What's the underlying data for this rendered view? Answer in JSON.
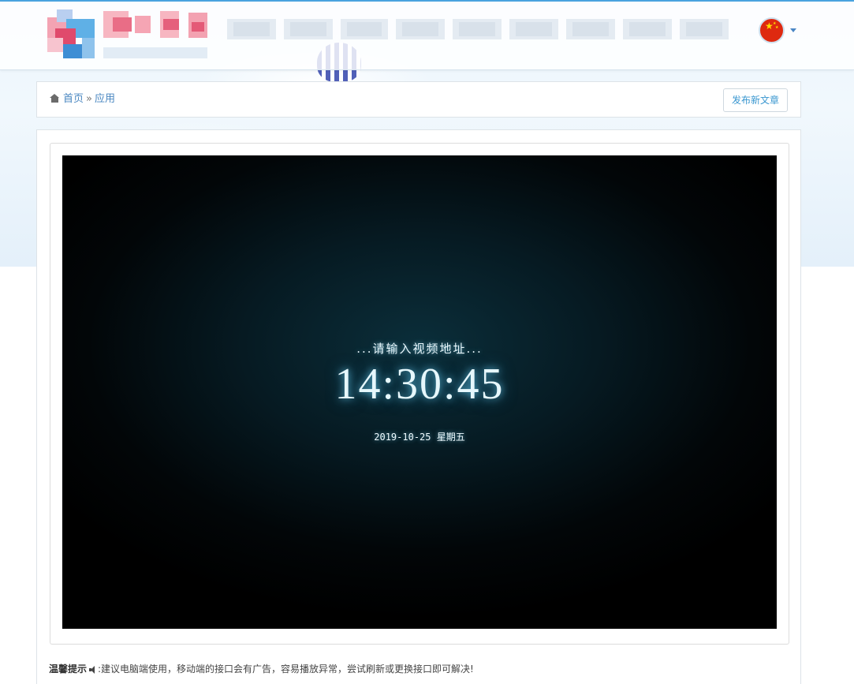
{
  "breadcrumb": {
    "home": "首页",
    "separator": "»",
    "current": "应用"
  },
  "actions": {
    "publish_label": "发布新文章"
  },
  "player": {
    "prompt": "...请输入视频地址...",
    "time": "14:30:45",
    "date": "2019-10-25 星期五"
  },
  "tip": {
    "title": "温馨提示",
    "text": ":建议电脑端使用，移动端的接口会有广告，容易播放异常，尝试刷新或更换接口即可解决!"
  },
  "language": {
    "flag": "china-flag-icon"
  },
  "colors": {
    "accent": "#3a97d0",
    "link": "#4a87c1",
    "glow": "#64c8eb"
  }
}
